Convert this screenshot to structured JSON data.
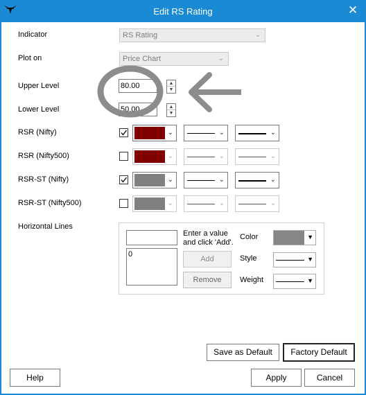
{
  "window": {
    "title": "Edit RS Rating",
    "close_glyph": "✕",
    "app_icon": "bull-logo-icon"
  },
  "form": {
    "indicator": {
      "label": "Indicator",
      "value": "RS Rating"
    },
    "plot_on": {
      "label": "Plot on",
      "value": "Price Chart"
    },
    "upper_level": {
      "label": "Upper Level",
      "value": "80.00"
    },
    "lower_level": {
      "label": "Lower Level",
      "value": "50.00"
    }
  },
  "series": [
    {
      "label": "RSR (Nifty)",
      "checked": true,
      "color": "#800000",
      "weight": "medium"
    },
    {
      "label": "RSR (Nifty500)",
      "checked": false,
      "color": "#800000",
      "weight": "thin"
    },
    {
      "label": "RSR-ST (Nifty)",
      "checked": true,
      "color": "#808080",
      "weight": "medium"
    },
    {
      "label": "RSR-ST (Nifty500)",
      "checked": false,
      "color": "#808080",
      "weight": "thin"
    }
  ],
  "horizontal_lines": {
    "label": "Horizontal Lines",
    "hint": "Enter a value and click 'Add'.",
    "list_values": [
      "0"
    ],
    "add_label": "Add",
    "remove_label": "Remove",
    "color_label": "Color",
    "style_label": "Style",
    "weight_label": "Weight",
    "color": "#868686"
  },
  "buttons": {
    "save_default": "Save as Default",
    "factory_default": "Factory Default",
    "help": "Help",
    "apply": "Apply",
    "cancel": "Cancel"
  },
  "annotation": {
    "circle_color": "#8c8c8c",
    "arrow_color": "#8c8c8c"
  }
}
